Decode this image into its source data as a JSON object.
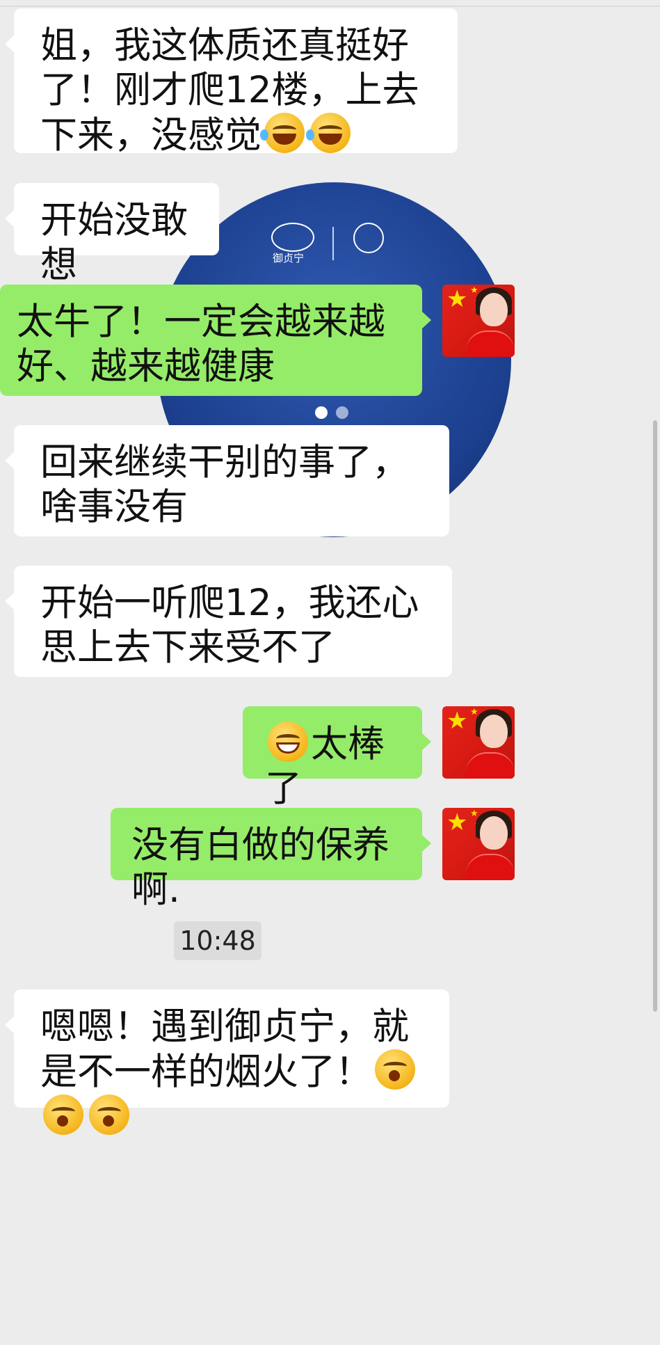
{
  "chat": {
    "messages": [
      {
        "dir": "in",
        "text": "姐，我这体质还真挺好了！刚才爬12楼，上去下来，没感觉",
        "emoji": [
          "laugh",
          "laugh"
        ]
      },
      {
        "dir": "in",
        "text": "开始没敢想"
      },
      {
        "dir": "out",
        "text": "太牛了！一定会越来越好、越来越健康"
      },
      {
        "dir": "in",
        "text": "回来继续干别的事了，啥事没有"
      },
      {
        "dir": "in",
        "text": "开始一听爬12，我还心思上去下来受不了"
      },
      {
        "dir": "out",
        "text": "太棒了",
        "emoji_before": "grin"
      },
      {
        "dir": "out",
        "text": "没有白做的保养啊."
      },
      {
        "dir": "in",
        "text": "嗯嗯！遇到御贞宁，就是不一样的烟火了！",
        "emoji": [
          "thinking",
          "thinking",
          "thinking"
        ]
      }
    ],
    "timestamp": "10:48"
  },
  "background_card": {
    "brand_text": "御贞宁",
    "carousel_dots": 2
  },
  "colors": {
    "chat_bg": "#ececec",
    "incoming_bubble": "#ffffff",
    "outgoing_bubble": "#95ec69",
    "card_blue": "#1c3f8e"
  },
  "icons": {
    "laugh_emoji": "face-with-tears-of-joy-icon",
    "grin_emoji": "grinning-face-icon",
    "thinking_emoji": "hand-over-mouth-emoji-icon",
    "avatar": "avatar-woman-red-flag"
  }
}
